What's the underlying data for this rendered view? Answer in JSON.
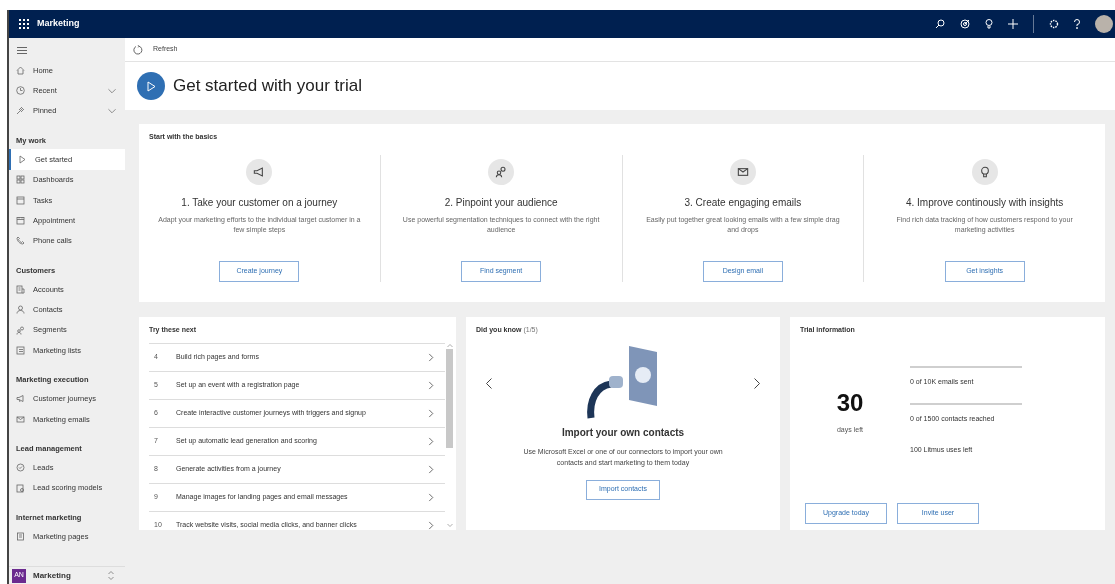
{
  "app_bar": {
    "title": "Marketing"
  },
  "sidebar": {
    "items": [
      {
        "kind": "item",
        "label": "Home",
        "selected": false
      },
      {
        "kind": "item",
        "label": "Recent",
        "selected": false,
        "expandable": true
      },
      {
        "kind": "item",
        "label": "Pinned",
        "selected": false,
        "expandable": true
      },
      {
        "kind": "header",
        "label": "My work"
      },
      {
        "kind": "item",
        "label": "Get started",
        "selected": true
      },
      {
        "kind": "item",
        "label": "Dashboards",
        "selected": false
      },
      {
        "kind": "item",
        "label": "Tasks",
        "selected": false
      },
      {
        "kind": "item",
        "label": "Appointment",
        "selected": false
      },
      {
        "kind": "item",
        "label": "Phone calls",
        "selected": false
      },
      {
        "kind": "header",
        "label": "Customers"
      },
      {
        "kind": "item",
        "label": "Accounts",
        "selected": false
      },
      {
        "kind": "item",
        "label": "Contacts",
        "selected": false
      },
      {
        "kind": "item",
        "label": "Segments",
        "selected": false
      },
      {
        "kind": "item",
        "label": "Marketing lists",
        "selected": false
      },
      {
        "kind": "header",
        "label": "Marketing execution"
      },
      {
        "kind": "item",
        "label": "Customer journeys",
        "selected": false
      },
      {
        "kind": "item",
        "label": "Marketing emails",
        "selected": false
      },
      {
        "kind": "header",
        "label": "Lead management"
      },
      {
        "kind": "item",
        "label": "Leads",
        "selected": false
      },
      {
        "kind": "item",
        "label": "Lead scoring models",
        "selected": false
      },
      {
        "kind": "header",
        "label": "Internet marketing"
      },
      {
        "kind": "item",
        "label": "Marketing pages",
        "selected": false
      }
    ],
    "area": {
      "initials": "AN",
      "label": "Marketing"
    }
  },
  "command_bar": {
    "refresh": "Refresh"
  },
  "page_title": "Get started with your trial",
  "basics": {
    "title": "Start with the basics",
    "steps": [
      {
        "title": "1. Take your customer on a journey",
        "text": "Adapt your marketing efforts to the individual target customer in a few simple steps",
        "button": "Create journey"
      },
      {
        "title": "2. Pinpoint your audience",
        "text": "Use powerful segmentation techniques to connect with the right audience",
        "button": "Find segment"
      },
      {
        "title": "3. Create engaging emails",
        "text": "Easily put together great looking emails with a few simple drag and drops",
        "button": "Design email"
      },
      {
        "title": "4. Improve continously with insights",
        "text": "Find rich data tracking of how customers respond to your marketing activities",
        "button": "Get insights"
      }
    ]
  },
  "try_next": {
    "title": "Try these next",
    "items": [
      {
        "number": "4",
        "label": "Build rich pages and forms"
      },
      {
        "number": "5",
        "label": "Set up an event with a registration page"
      },
      {
        "number": "6",
        "label": "Create interactive customer journeys with triggers and signup"
      },
      {
        "number": "7",
        "label": "Set up automatic lead generation and scoring"
      },
      {
        "number": "8",
        "label": "Generate activities from a journey"
      },
      {
        "number": "9",
        "label": "Manage images for landing pages and email messages"
      },
      {
        "number": "10",
        "label": "Track website visits, social media clicks, and banner clicks"
      }
    ]
  },
  "did_you_know": {
    "title": "Did you know",
    "counter": "(1/5)",
    "heading": "Import your own contacts",
    "text": "Use Microsoft Excel or one of our connectors to import your own contacts and start marketing to them today",
    "button": "Import contacts"
  },
  "trial": {
    "title": "Trial information",
    "days": "30",
    "days_label": "days left",
    "meters": [
      {
        "level": 0,
        "label": "0 of 10K emails sent"
      },
      {
        "level": 0,
        "label": "0 of 1500 contacts reached"
      }
    ],
    "note": "100 Litmus uses left",
    "buttons": [
      "Upgrade today",
      "Invite user"
    ]
  }
}
